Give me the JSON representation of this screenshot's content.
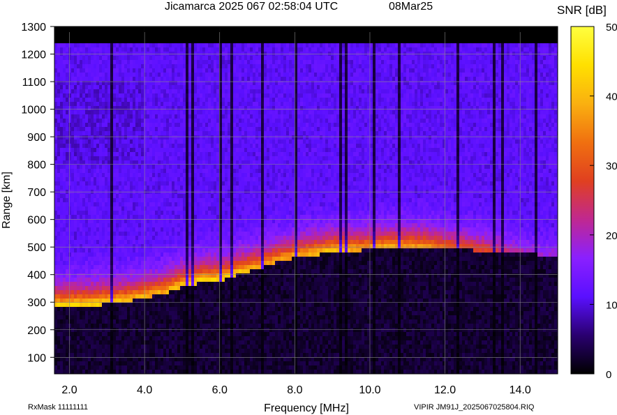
{
  "chart_data": {
    "type": "heatmap",
    "title": "Jicamarca 2025 067 02:58:04 UTC",
    "date_label": "08Mar25",
    "xlabel": "Frequency [MHz]",
    "ylabel": "Range [km]",
    "xlim": [
      1.6,
      15.0
    ],
    "ylim": [
      40,
      1300
    ],
    "x_ticks": [
      2.0,
      4.0,
      6.0,
      8.0,
      10.0,
      12.0,
      14.0
    ],
    "x_tick_labels": [
      "2.0",
      "4.0",
      "6.0",
      "8.0",
      "10.0",
      "12.0",
      "14.0"
    ],
    "y_ticks": [
      100,
      200,
      300,
      400,
      500,
      600,
      700,
      800,
      900,
      1000,
      1100,
      1200,
      1300
    ],
    "y_tick_labels": [
      "100",
      "200",
      "300",
      "400",
      "500",
      "600",
      "700",
      "800",
      "900",
      "1000",
      "1100",
      "1200",
      "1300"
    ],
    "colorbar": {
      "label": "SNR [dB]",
      "range": [
        0,
        50
      ],
      "ticks": [
        0,
        10,
        20,
        30,
        40,
        50
      ],
      "tick_labels": [
        "0",
        "10",
        "20",
        "30",
        "40",
        "50"
      ],
      "colors": [
        "#000000",
        "#2a0070",
        "#5a10ff",
        "#8a20ff",
        "#c02890",
        "#e04020",
        "#f07010",
        "#fab010",
        "#ffe000",
        "#ffff40"
      ]
    },
    "data_ceiling_km": 1240,
    "grid": true,
    "echo_trace": [
      {
        "f": 1.6,
        "range_km": 290,
        "snr_db": 32
      },
      {
        "f": 2.5,
        "range_km": 295,
        "snr_db": 33
      },
      {
        "f": 3.5,
        "range_km": 310,
        "snr_db": 30
      },
      {
        "f": 4.5,
        "range_km": 340,
        "snr_db": 28
      },
      {
        "f": 5.0,
        "range_km": 365,
        "snr_db": 31
      },
      {
        "f": 5.5,
        "range_km": 380,
        "snr_db": 33
      },
      {
        "f": 6.0,
        "range_km": 385,
        "snr_db": 32
      },
      {
        "f": 6.5,
        "range_km": 410,
        "snr_db": 31
      },
      {
        "f": 7.0,
        "range_km": 430,
        "snr_db": 28
      },
      {
        "f": 7.5,
        "range_km": 455,
        "snr_db": 27
      },
      {
        "f": 8.0,
        "range_km": 470,
        "snr_db": 28
      },
      {
        "f": 8.5,
        "range_km": 480,
        "snr_db": 29
      },
      {
        "f": 9.0,
        "range_km": 490,
        "snr_db": 31
      },
      {
        "f": 9.5,
        "range_km": 495,
        "snr_db": 28
      },
      {
        "f": 10.0,
        "range_km": 500,
        "snr_db": 27
      },
      {
        "f": 10.5,
        "range_km": 505,
        "snr_db": 28
      },
      {
        "f": 11.0,
        "range_km": 505,
        "snr_db": 27
      },
      {
        "f": 11.5,
        "range_km": 505,
        "snr_db": 26
      },
      {
        "f": 12.0,
        "range_km": 500,
        "snr_db": 22
      },
      {
        "f": 12.5,
        "range_km": 500,
        "snr_db": 20
      },
      {
        "f": 13.0,
        "range_km": 495,
        "snr_db": 18
      },
      {
        "f": 13.5,
        "range_km": 490,
        "snr_db": 14
      },
      {
        "f": 14.0,
        "range_km": 485,
        "snr_db": 10
      },
      {
        "f": 15.0,
        "range_km": 480,
        "snr_db": 8
      }
    ]
  },
  "footer": {
    "rxmask": "RxMask 11111111",
    "file": "VIPIR  JM91J_2025067025804.RIQ"
  }
}
